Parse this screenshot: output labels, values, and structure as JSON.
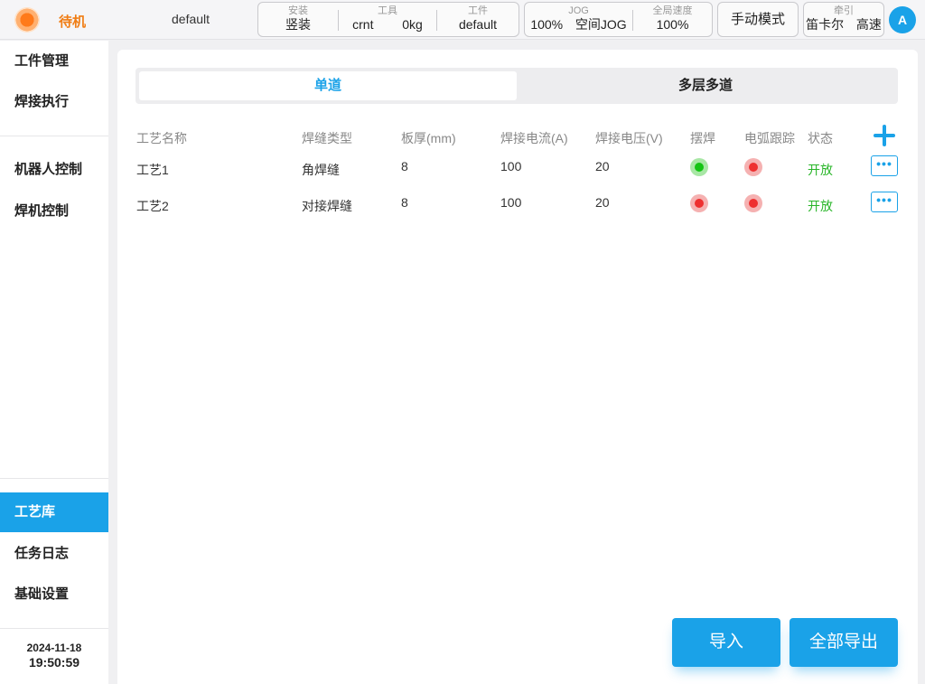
{
  "status": {
    "text": "待机",
    "color": "#f07d14"
  },
  "project": {
    "name": "default"
  },
  "topbar": {
    "install": {
      "caption": "安装",
      "value": "竖装"
    },
    "tool": {
      "caption": "工具",
      "name": "crnt",
      "load": "0kg"
    },
    "workpiece": {
      "caption": "工件",
      "value": "default"
    },
    "jog": {
      "caption": "JOG",
      "percent": "100%",
      "mode": "空间JOG"
    },
    "global_speed": {
      "caption": "全局速度",
      "value": "100%"
    },
    "manual_mode_label": "手动模式",
    "traction": {
      "caption": "牵引",
      "coord": "笛卡尔",
      "speed": "高速"
    },
    "avatar_letter": "A"
  },
  "sidebar": {
    "items": [
      {
        "label": "工件管理"
      },
      {
        "label": "焊接执行"
      },
      {
        "label": "机器人控制"
      },
      {
        "label": "焊机控制"
      },
      {
        "label": "工艺库",
        "active": true
      },
      {
        "label": "任务日志"
      },
      {
        "label": "基础设置"
      }
    ],
    "date": "2024-11-18",
    "time": "19:50:59"
  },
  "tabs": [
    {
      "label": "单道",
      "active": true
    },
    {
      "label": "多层多道",
      "active": false
    }
  ],
  "table": {
    "headers": [
      "工艺名称",
      "焊缝类型",
      "板厚(mm)",
      "焊接电流(A)",
      "焊接电压(V)",
      "摆焊",
      "电弧跟踪",
      "状态"
    ],
    "rows": [
      {
        "name": "工艺1",
        "seam": "角焊缝",
        "thickness": "8",
        "current": "100",
        "voltage": "20",
        "weave": "on",
        "arc_tracking": "off",
        "status": "开放"
      },
      {
        "name": "工艺2",
        "seam": "对接焊缝",
        "thickness": "8",
        "current": "100",
        "voltage": "20",
        "weave": "off",
        "arc_tracking": "off",
        "status": "开放"
      }
    ],
    "more_label": "•••"
  },
  "actions": {
    "import_label": "导入",
    "export_all_label": "全部导出"
  },
  "colors": {
    "accent": "#1aa2e8",
    "indicator_on": "#14c414",
    "indicator_off": "#ee3030",
    "status_open": "#28b528"
  }
}
